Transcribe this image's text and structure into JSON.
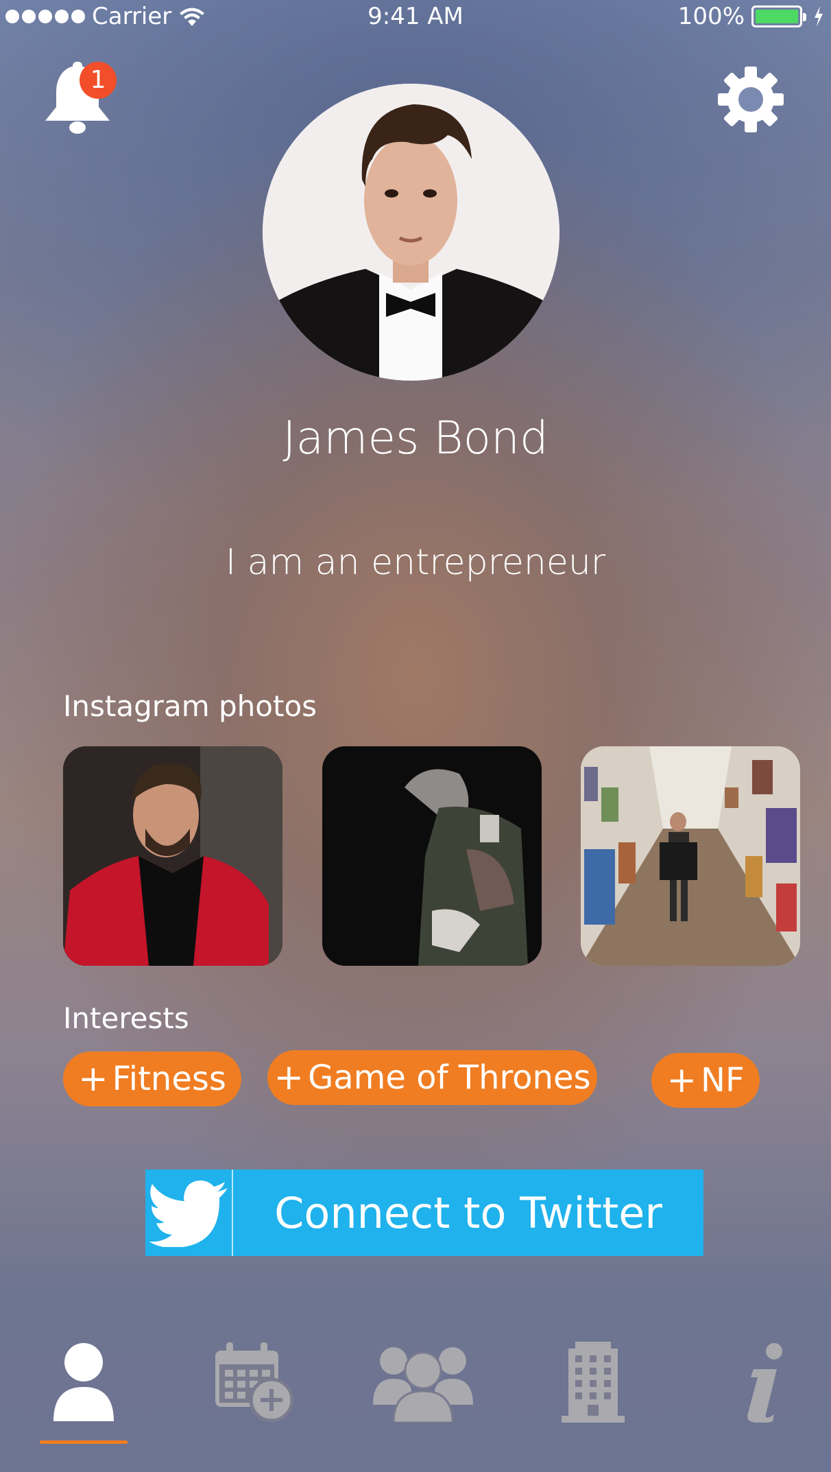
{
  "status_bar": {
    "carrier": "Carrier",
    "time": "9:41 AM",
    "battery": "100%"
  },
  "header": {
    "notification_count": "1"
  },
  "profile": {
    "name": "James Bond",
    "bio": "I am an entrepreneur"
  },
  "instagram": {
    "label": "Instagram photos"
  },
  "interests": {
    "label": "Interests",
    "items": [
      {
        "plus": "+",
        "label": "Fitness"
      },
      {
        "plus": "+",
        "label": "Game of Thrones"
      },
      {
        "plus": "+",
        "label": "NF"
      }
    ]
  },
  "twitter_button": {
    "label": "Connect to Twitter"
  },
  "tabs": [
    {
      "icon": "profile-icon",
      "active": true
    },
    {
      "icon": "calendar-add-icon",
      "active": false
    },
    {
      "icon": "group-icon",
      "active": false
    },
    {
      "icon": "building-icon",
      "active": false
    },
    {
      "icon": "info-icon",
      "active": false
    }
  ],
  "colors": {
    "accent": "#f07d22",
    "badge": "#f24e2a",
    "twitter": "#1fb2ec",
    "battery": "#4cd964",
    "inactive_tab": "#a9a9ae"
  }
}
